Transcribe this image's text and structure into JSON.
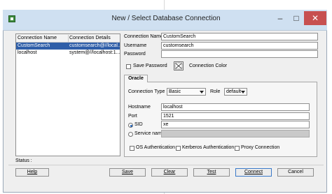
{
  "dialog": {
    "title": "New / Select Database Connection"
  },
  "window_controls": {
    "minimize": "–",
    "maximize": "□",
    "close": "✕"
  },
  "list": {
    "columns": [
      "Connection Name",
      "Connection Details"
    ],
    "rows": [
      {
        "name": "CustomSearch",
        "details": "customsearch@//local..."
      },
      {
        "name": "localhost",
        "details": "system@//localhost:1..."
      }
    ]
  },
  "form": {
    "connection_name_label": "Connection Name",
    "connection_name_value": "CustomSearch",
    "username_label": "Username",
    "username_value": "customsearch",
    "password_label": "Password",
    "password_value": "",
    "save_password_label": "Save Password",
    "connection_color_label": "Connection Color"
  },
  "tabs": {
    "oracle": "Oracle"
  },
  "oracle": {
    "connection_type_label": "Connection Type",
    "connection_type_value": "Basic",
    "role_label": "Role",
    "role_value": "default",
    "hostname_label": "Hostname",
    "hostname_value": "localhost",
    "port_label": "Port",
    "port_value": "1521",
    "sid_label": "SID",
    "sid_value": "xe",
    "service_name_label": "Service name",
    "os_auth_label": "OS Authentication",
    "kerberos_label": "Kerberos Authentication",
    "proxy_label": "Proxy Connection"
  },
  "status": {
    "label": "Status :"
  },
  "buttons": {
    "help": "Help",
    "save": "Save",
    "clear": "Clear",
    "test": "Test",
    "connect": "Connect",
    "cancel": "Cancel"
  }
}
